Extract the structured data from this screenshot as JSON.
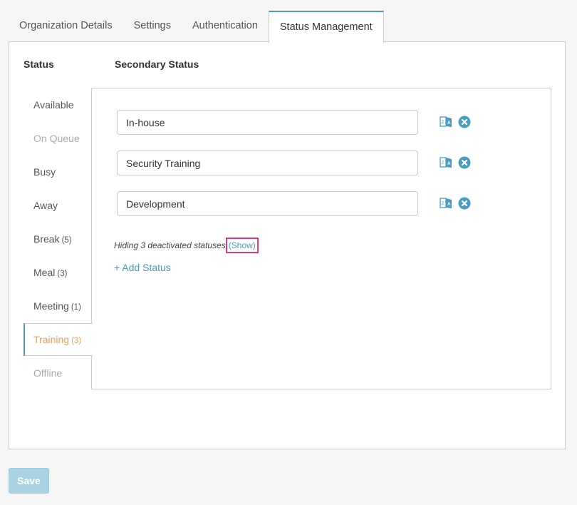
{
  "tabs": [
    {
      "label": "Organization Details"
    },
    {
      "label": "Settings"
    },
    {
      "label": "Authentication"
    },
    {
      "label": "Status Management",
      "active": true
    }
  ],
  "columns": {
    "status": "Status",
    "secondary": "Secondary Status"
  },
  "statuses": [
    {
      "label": "Available",
      "count": ""
    },
    {
      "label": "On Queue",
      "count": ""
    },
    {
      "label": "Busy",
      "count": ""
    },
    {
      "label": "Away",
      "count": ""
    },
    {
      "label": "Break",
      "count": "(5)"
    },
    {
      "label": "Meal",
      "count": "(3)"
    },
    {
      "label": "Meeting",
      "count": "(1)"
    },
    {
      "label": "Training",
      "count": "(3)"
    },
    {
      "label": "Offline",
      "count": ""
    }
  ],
  "secondary_statuses": [
    {
      "value": "In-house"
    },
    {
      "value": "Security Training"
    },
    {
      "value": "Development"
    }
  ],
  "hidden_note": "Hiding 3 deactivated statuses",
  "show_link": "(Show)",
  "add_status": "+ Add Status",
  "save_label": "Save",
  "colors": {
    "accent": "#4a9bc0",
    "selected_status": "#e8a05a",
    "highlight_box": "#e0397a"
  },
  "icons": {
    "translate": "translate-icon",
    "remove": "remove-circle-icon"
  }
}
